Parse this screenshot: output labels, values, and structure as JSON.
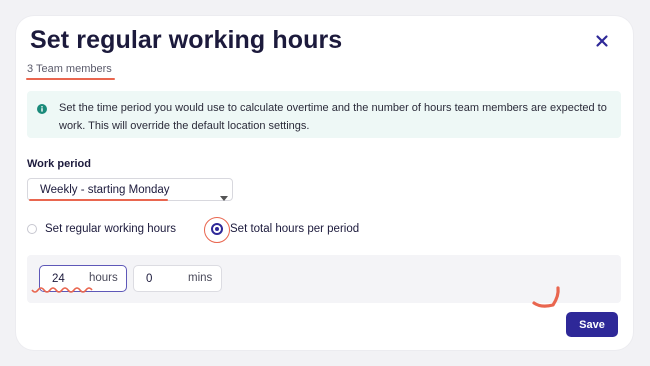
{
  "dialog": {
    "title": "Set regular working hours",
    "subtitle": "3 Team members",
    "close_icon": "close-icon"
  },
  "info": {
    "icon": "info-icon",
    "text": "Set the time period you would use to calculate overtime and the number of hours team members are expected to work. This will override the default location settings."
  },
  "work_period": {
    "label": "Work period",
    "selected": "Weekly - starting Monday",
    "caret_icon": "chevron-down-icon"
  },
  "mode_options": [
    {
      "label": "Set regular working hours",
      "selected": false
    },
    {
      "label": "Set total hours per period",
      "selected": true
    }
  ],
  "total": {
    "hours_value": "24",
    "hours_unit": "hours",
    "mins_value": "0",
    "mins_unit": "mins"
  },
  "actions": {
    "save_label": "Save"
  },
  "colors": {
    "primary": "#2e2898",
    "info_background": "#eef8f6",
    "annotation": "#e9664f",
    "title": "#1c1a3c"
  }
}
